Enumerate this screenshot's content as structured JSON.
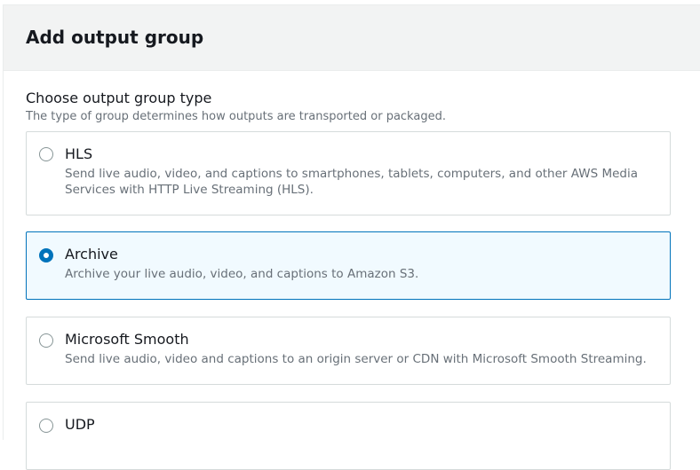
{
  "panel": {
    "title": "Add output group"
  },
  "field": {
    "label": "Choose output group type",
    "description": "The type of group determines how outputs are transported or packaged."
  },
  "options": [
    {
      "title": "HLS",
      "description": "Send live audio, video, and captions to smartphones, tablets, computers, and other AWS Media Services with HTTP Live Streaming (HLS).",
      "selected": false
    },
    {
      "title": "Archive",
      "description": "Archive your live audio, video, and captions to Amazon S3.",
      "selected": true
    },
    {
      "title": "Microsoft Smooth",
      "description": "Send live audio, video and captions to an origin server or CDN with Microsoft Smooth Streaming.",
      "selected": false
    },
    {
      "title": "UDP",
      "description": "",
      "selected": false
    }
  ],
  "colors": {
    "accent": "#0073bb",
    "selected_bg": "#f1faff",
    "header_bg": "#f2f3f3"
  }
}
